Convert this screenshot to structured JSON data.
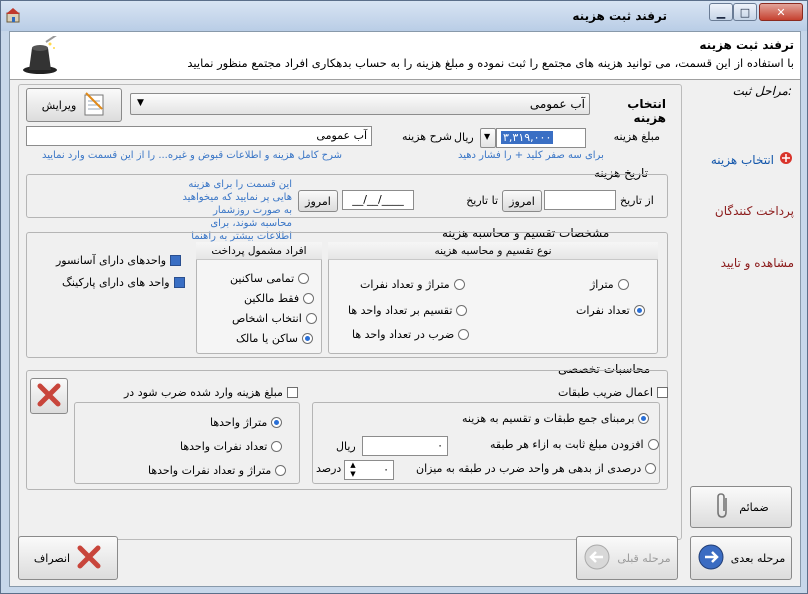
{
  "window": {
    "title": "ترفند ثبت هزینه",
    "minimize": "▁",
    "maximize": "□",
    "close": "✕"
  },
  "header": {
    "title": "ترفند ثبت هزینه",
    "description": "با استفاده از این قسمت، می توانید هزینه های مجتمع را ثبت نموده و مبلغ هزینه را به حساب بدهکاری افراد مجتمع منظور نمایید"
  },
  "sidebar": {
    "title": "مراحل ثبت:",
    "steps": [
      "انتخاب هزینه",
      "پرداخت کنندگان",
      "مشاهده و تایید"
    ],
    "attach_label": "ضمائم"
  },
  "expense": {
    "select_label": "انتخاب هزینه",
    "selected_value": "آب عمومی",
    "edit_label": "ویرایش",
    "amount_label": "مبلغ هزینه",
    "amount_value": "۳,۳۱۹,۰۰۰",
    "currency": "ریال",
    "amount_hint": "برای سه صفر کلید + را فشار دهید",
    "desc_label": "شرح هزینه",
    "desc_value": "آب عمومی",
    "desc_hint": "شرح کامل هزینه و اطلاعات قبوض و غیره... را از این قسمت وارد نمایید"
  },
  "date": {
    "title": "تاریخ هزینه",
    "from_label": "از تاریخ",
    "to_label": "تا تاریخ",
    "from_value": "",
    "to_value": "__/__/____",
    "today": "امروز",
    "info": "این قسمت را برای هزینه هایی پر نمایید که میخواهید به صورت روزشمار محاسبه شوند، برای اطلاعات بیشتر به راهنما مراجعه فرمایید"
  },
  "calc": {
    "title": "مشخصات تقسیم و محاسبه هزینه",
    "type_title": "نوع تقسیم و محاسبه هزینه",
    "type_options": [
      "متراژ",
      "متراژ و تعداد نفرات",
      "تعداد نفرات",
      "تقسیم بر تعداد واحد ها",
      "ضرب در تعداد واحد ها"
    ],
    "selected_type": "تعداد نفرات",
    "persons_title": "افراد مشمول پرداخت",
    "persons_options": [
      "تمامی ساکنین",
      "فقط مالکین",
      "انتخاب اشخاص",
      "ساکن یا مالک"
    ],
    "selected_person": "ساکن یا مالک",
    "checks": [
      "واحدهای دارای آسانسور",
      "واحد های دارای پارکینگ"
    ]
  },
  "special": {
    "title": "محاسبات تخصصی",
    "floor_coef": "اعمال ضریب طبقات",
    "floor_options": [
      "برمبنای جمع طبقات و تقسیم به هزینه",
      "افزودن مبلغ ثابت به ازاء هر طبقه",
      "درصدی از بدهی هر واحد ضرب در طبقه به میزان"
    ],
    "fixed_value": "۰",
    "fixed_unit": "ریال",
    "percent_value": "۰",
    "percent_unit": "درصد",
    "multiply_label": "مبلغ هزینه وارد شده ضرب شود در",
    "multiply_options": [
      "متراژ واحدها",
      "تعداد نفرات واحدها",
      "متراژ و تعداد نفرات واحدها"
    ]
  },
  "footer": {
    "next": "مرحله بعدی",
    "prev": "مرحله قبلی",
    "cancel": "انصراف"
  },
  "colors": {
    "accent": "#3a6fc4",
    "step_active": "#1155aa",
    "step_inactive": "#8b1a1a",
    "hint": "#3a76c6"
  }
}
